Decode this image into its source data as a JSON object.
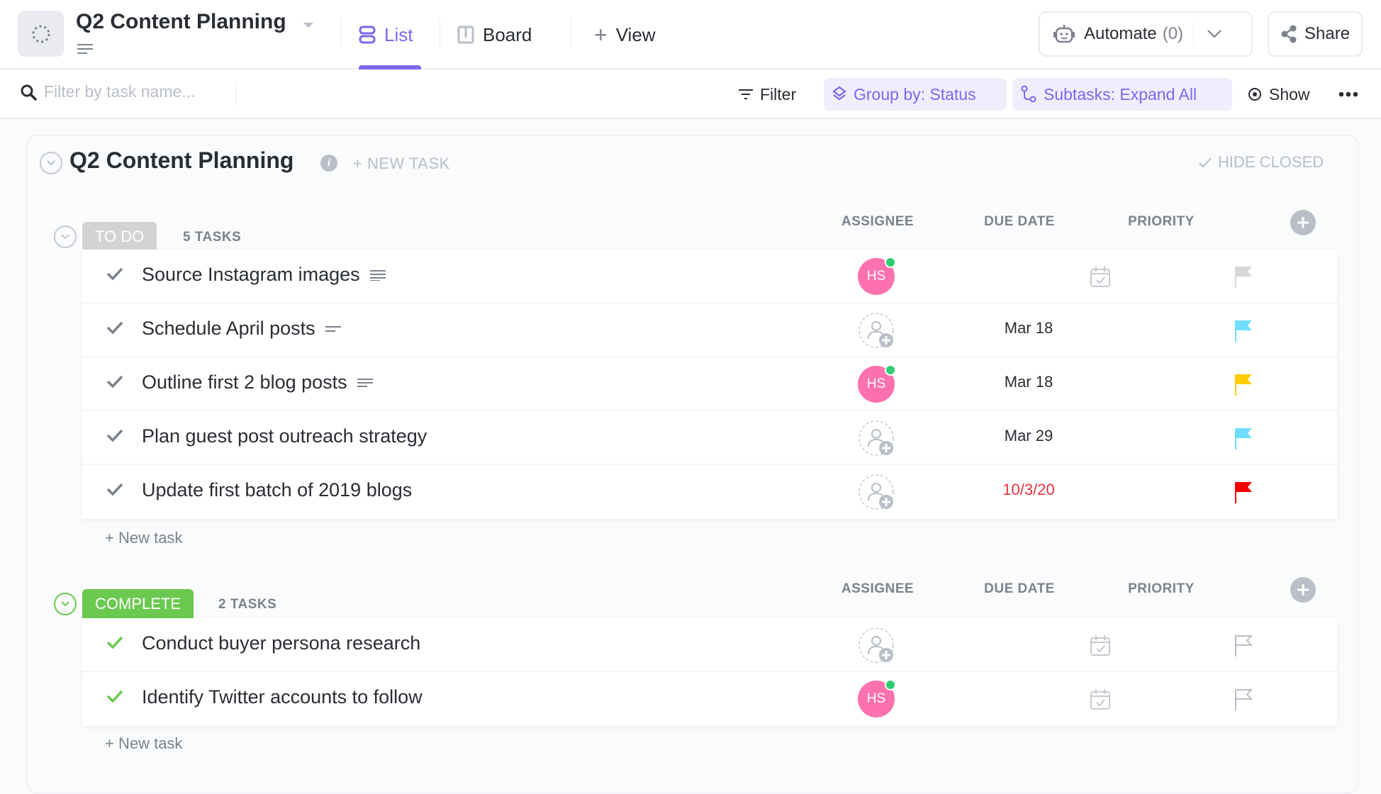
{
  "header": {
    "title": "Q2 Content Planning",
    "tabs": [
      {
        "label": "List",
        "active": true
      },
      {
        "label": "Board",
        "active": false
      }
    ],
    "add_view_label": "View",
    "automate_label": "Automate",
    "automate_count": "(0)",
    "share_label": "Share"
  },
  "toolbar": {
    "search_placeholder": "Filter by task name...",
    "filter_label": "Filter",
    "group_by_label": "Group by: Status",
    "subtasks_label": "Subtasks: Expand All",
    "show_label": "Show"
  },
  "list": {
    "title": "Q2 Content Planning",
    "new_task_label": "+ NEW TASK",
    "hide_closed_label": "HIDE CLOSED",
    "columns": [
      "ASSIGNEE",
      "DUE DATE",
      "PRIORITY"
    ],
    "groups": [
      {
        "status": "TO DO",
        "status_color": "#d3d3d3",
        "count_label": "5 TASKS",
        "new_task_label": "+ New task",
        "tasks": [
          {
            "name": "Source Instagram images",
            "has_description": true,
            "assignee": "HS",
            "due": "",
            "priority": "none"
          },
          {
            "name": "Schedule April posts",
            "has_description": true,
            "assignee": "",
            "due": "Mar 18",
            "priority": "low"
          },
          {
            "name": "Outline first 2 blog posts",
            "has_description": true,
            "assignee": "HS",
            "due": "Mar 18",
            "priority": "high"
          },
          {
            "name": "Plan guest post outreach strategy",
            "has_description": false,
            "assignee": "",
            "due": "Mar 29",
            "priority": "low"
          },
          {
            "name": "Update first batch of 2019 blogs",
            "has_description": false,
            "assignee": "",
            "due": "10/3/20",
            "overdue": true,
            "priority": "urgent"
          }
        ]
      },
      {
        "status": "COMPLETE",
        "status_color": "#6bc950",
        "count_label": "2 TASKS",
        "new_task_label": "+ New task",
        "tasks": [
          {
            "name": "Conduct buyer persona research",
            "has_description": false,
            "assignee": "",
            "due": "",
            "priority": "empty"
          },
          {
            "name": "Identify Twitter accounts to follow",
            "has_description": false,
            "assignee": "HS",
            "due": "",
            "priority": "empty"
          }
        ]
      }
    ]
  },
  "colors": {
    "accent": "#7b68ee",
    "priority_none": "#d8d8d8",
    "priority_low": "#6fddff",
    "priority_high": "#ffcc00",
    "priority_urgent": "#f50000",
    "avatar": "#fd71af",
    "overdue": "#e5323f"
  }
}
